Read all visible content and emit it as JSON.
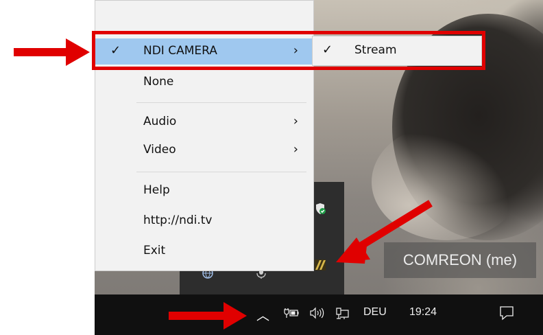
{
  "menu": {
    "items": [
      {
        "label": "NDI CAMERA",
        "checked": true,
        "has_submenu": true,
        "selected": true
      },
      {
        "label": "None",
        "checked": false,
        "has_submenu": false,
        "selected": false
      },
      {
        "label": "Audio",
        "checked": false,
        "has_submenu": true,
        "selected": false
      },
      {
        "label": "Video",
        "checked": false,
        "has_submenu": true,
        "selected": false
      },
      {
        "label": "Help",
        "checked": false,
        "has_submenu": false,
        "selected": false
      },
      {
        "label": "http://ndi.tv",
        "checked": false,
        "has_submenu": false,
        "selected": false
      },
      {
        "label": "Exit",
        "checked": false,
        "has_submenu": false,
        "selected": false
      }
    ],
    "check_glyph": "✓",
    "chevron_glyph": "›"
  },
  "submenu": {
    "items": [
      {
        "label": "Stream",
        "checked": true
      }
    ]
  },
  "video": {
    "participant_label": "COMREON (me)"
  },
  "taskbar": {
    "language": "DEU",
    "time": "19:24",
    "icons": [
      "chevron-up-icon",
      "battery-plug-icon",
      "speaker-icon",
      "network-icon",
      "notification-icon"
    ]
  },
  "colors": {
    "highlight": "#e00000",
    "arrow": "#e00000",
    "selected_item": "#9fc8ef",
    "menu_background": "#f2f2f2",
    "taskbar": "#101010"
  }
}
